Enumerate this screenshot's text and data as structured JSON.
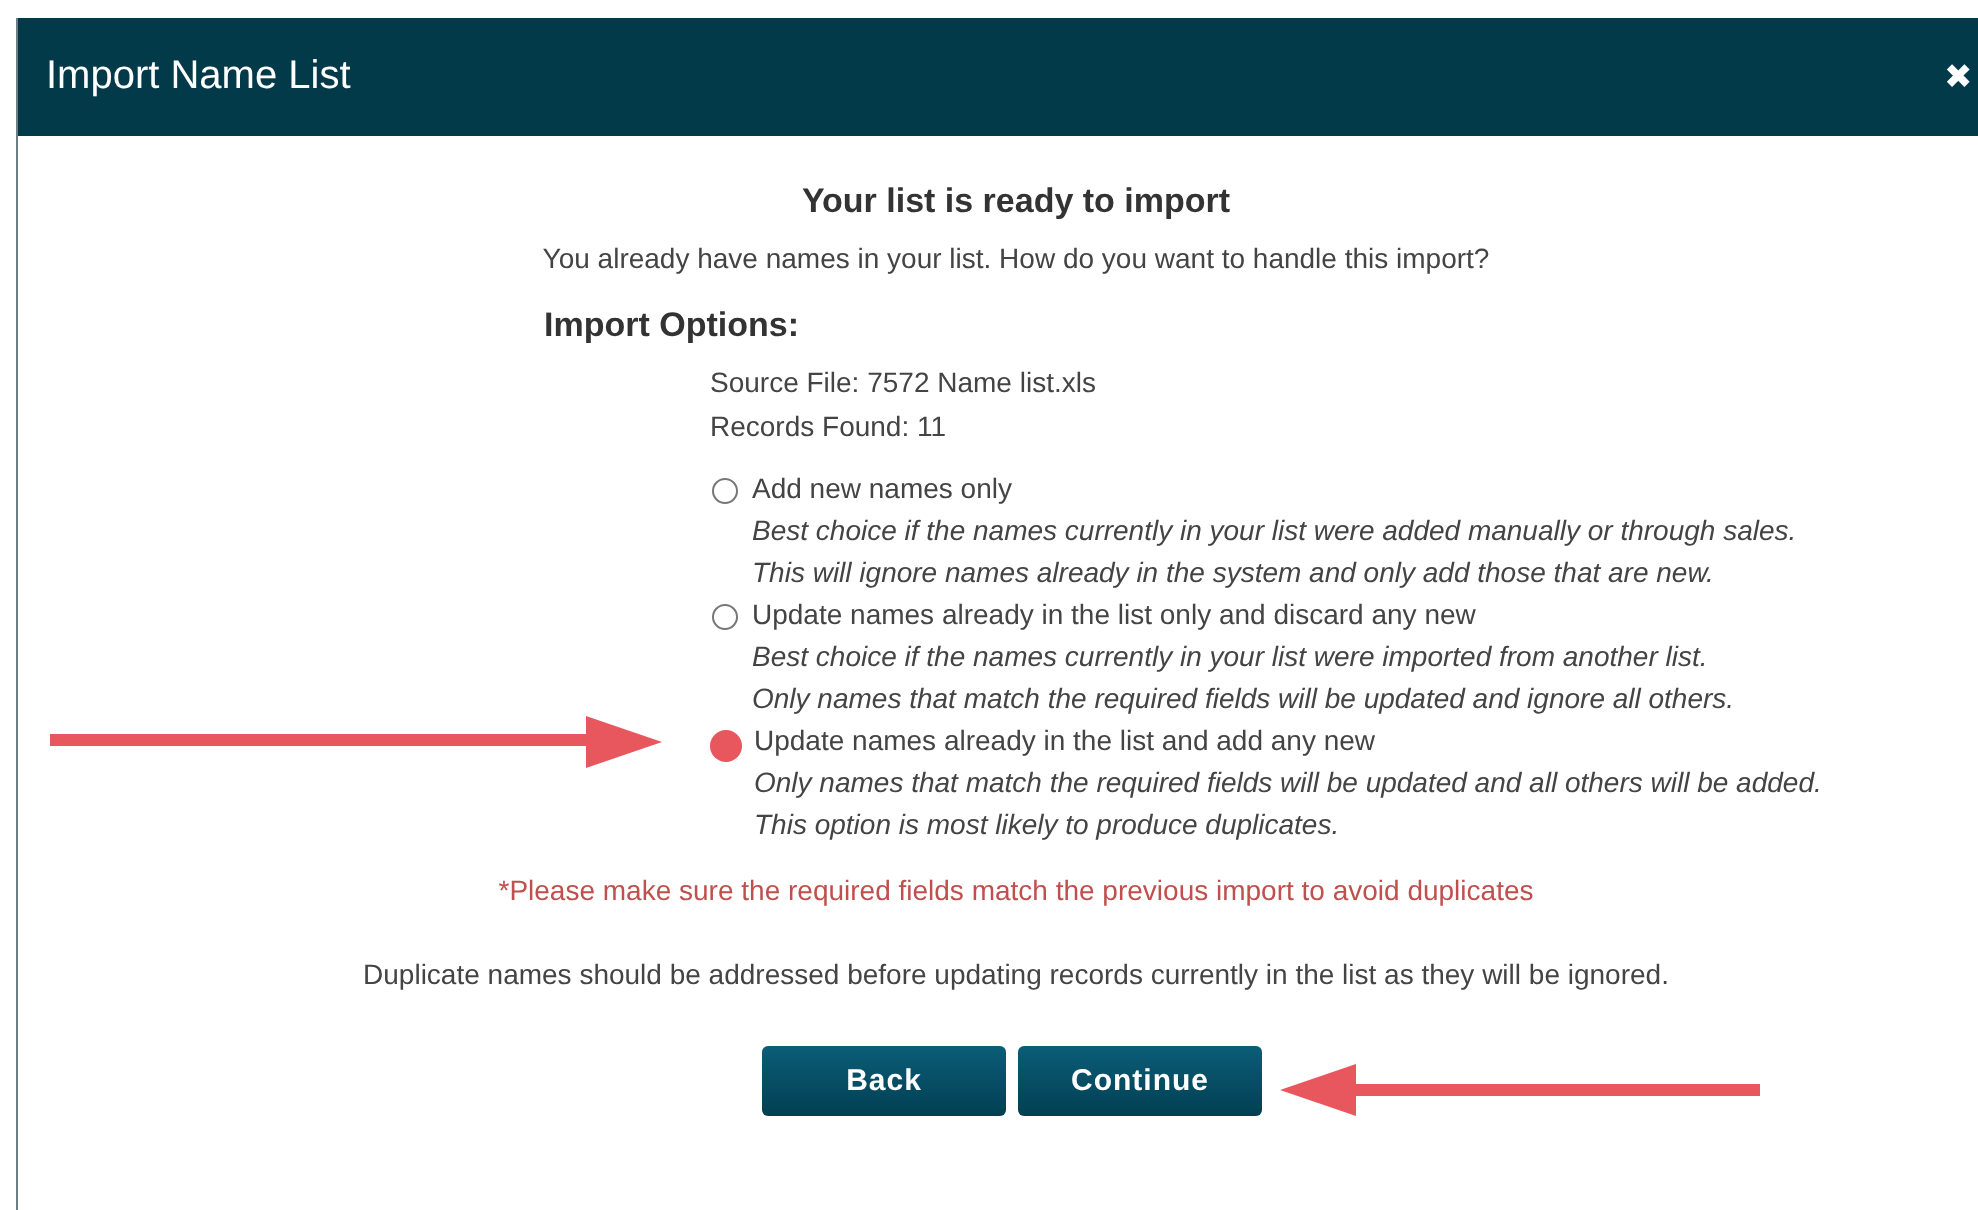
{
  "dialog": {
    "title": "Import Name List",
    "close": "✖"
  },
  "heading": "Your list is ready to import",
  "intro": "You already have names in your list. How do you want to handle this import?",
  "options_heading": "Import Options:",
  "file_info": [
    "Source File: 7572 Name list.xls",
    "Records Found: 11"
  ],
  "options": [
    {
      "label": "Add new names only",
      "selected": false,
      "notes": [
        "Best choice if the names currently in your list were added manually or through sales.",
        "This will ignore names already in the system and only add those that are new."
      ]
    },
    {
      "label": "Update names already in the list only and discard any new",
      "selected": false,
      "notes": [
        "Best choice if the names currently in your list were imported from another list.",
        "Only names that match the required fields will be updated and ignore all others."
      ]
    },
    {
      "label": "Update names already in the list and add any new",
      "selected": true,
      "notes": [
        "Only names that match the required fields will be updated and all others will be added.",
        "This option is most likely to produce duplicates."
      ]
    }
  ],
  "warning": "*Please make sure the required fields match the previous import to avoid duplicates",
  "note": "Duplicate names should be addressed before updating records currently in the list as they will be ignored.",
  "buttons": [
    "Back",
    "Continue"
  ]
}
